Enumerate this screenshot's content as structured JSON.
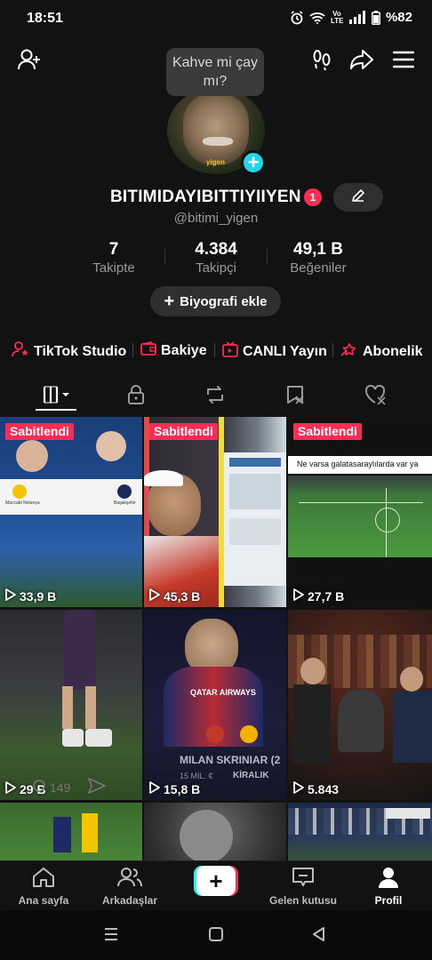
{
  "status_bar": {
    "time": "18:51",
    "network": "Vo LTE",
    "battery": "%82",
    "icons": [
      "alarm-icon",
      "wifi-icon",
      "signal-icon",
      "battery-icon"
    ]
  },
  "top_bar": {
    "icons": [
      "add-friend-icon",
      "footprints-icon",
      "share-icon",
      "menu-icon"
    ]
  },
  "profile": {
    "note_bubble": "Kahve mi çay mı?",
    "avatar_watermark": "yigen",
    "username": "BITIMIDAYIBITTIYIIYEN",
    "notification_count": "1",
    "handle": "@bitimi_yigen",
    "stats": [
      {
        "value": "7",
        "label": "Takipte"
      },
      {
        "value": "4.384",
        "label": "Takipçi"
      },
      {
        "value": "49,1 B",
        "label": "Beğeniler"
      }
    ],
    "bio_button": "Biyografi ekle"
  },
  "shortcuts": [
    {
      "label": "TikTok Studio",
      "icon": "person-star-icon"
    },
    {
      "label": "Bakiye",
      "icon": "wallet-icon"
    },
    {
      "label": "CANLI Yayın",
      "icon": "live-tv-icon"
    },
    {
      "label": "Abonelik",
      "icon": "subscription-icon"
    }
  ],
  "tabs": [
    "videos-grid-icon",
    "lock-icon",
    "repost-icon",
    "favorites-icon",
    "liked-icon"
  ],
  "videos": [
    {
      "pinned": "Sabitlendi",
      "views": "33,9 B",
      "caption": "",
      "mini_left": "Maccabi Netanya",
      "mini_right": "Başakşehir"
    },
    {
      "pinned": "Sabitlendi",
      "views": "45,3 B",
      "caption": ""
    },
    {
      "pinned": "Sabitlendi",
      "views": "27,7 B",
      "caption": "Ne varsa galatasaraylılarda var ya"
    },
    {
      "pinned": "",
      "views": "29 B",
      "caption": "",
      "comment_count": "149"
    },
    {
      "pinned": "",
      "views": "15,8 B",
      "caption": "MILAN SKRINIAR (2",
      "sub_caption": "KİRALIK",
      "price": "15 MİL. €",
      "shirt": "QATAR AIRWAYS"
    },
    {
      "pinned": "",
      "views": "5.843",
      "caption": ""
    },
    {
      "pinned": "",
      "views": "",
      "caption": ""
    },
    {
      "pinned": "",
      "views": "",
      "caption": ""
    },
    {
      "pinned": "",
      "views": "",
      "caption": ""
    }
  ],
  "bottom_nav": [
    {
      "label": "Ana sayfa",
      "icon": "home-icon"
    },
    {
      "label": "Arkadaşlar",
      "icon": "friends-icon"
    },
    {
      "label": "",
      "icon": "create-plus-icon"
    },
    {
      "label": "Gelen kutusu",
      "icon": "inbox-icon"
    },
    {
      "label": "Profil",
      "icon": "profile-icon"
    }
  ],
  "system_nav": [
    "recent-apps-icon",
    "home-button-icon",
    "back-icon"
  ],
  "colors": {
    "accent_red": "#fe2c55",
    "accent_cyan": "#25f4ee",
    "background": "#121212"
  }
}
